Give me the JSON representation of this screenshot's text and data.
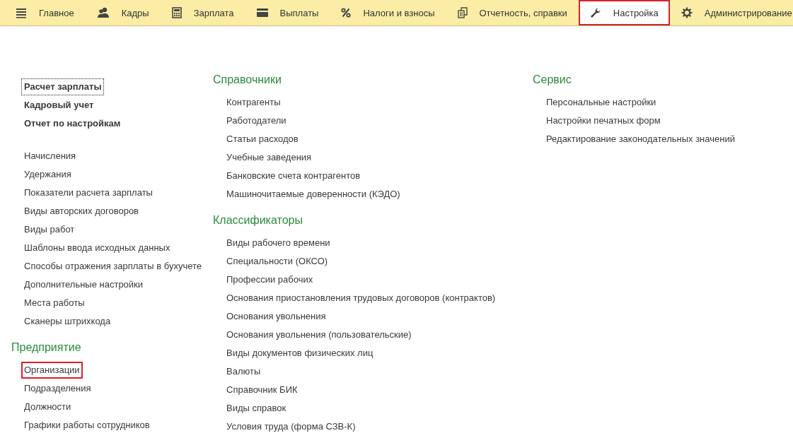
{
  "tabs": [
    {
      "label": "Главное",
      "selected": false,
      "highlighted": false
    },
    {
      "label": "Кадры",
      "selected": false,
      "highlighted": false
    },
    {
      "label": "Зарплата",
      "selected": false,
      "highlighted": false
    },
    {
      "label": "Выплаты",
      "selected": false,
      "highlighted": false
    },
    {
      "label": "Налоги и взносы",
      "selected": false,
      "highlighted": false
    },
    {
      "label": "Отчетность, справки",
      "selected": false,
      "highlighted": false
    },
    {
      "label": "Настройка",
      "selected": true,
      "highlighted": true
    },
    {
      "label": "Администрирование",
      "selected": false,
      "highlighted": false
    }
  ],
  "columns": [
    {
      "groups": [
        {
          "kind": "bold",
          "items": [
            {
              "label": "Расчет зарплаты",
              "focused": true,
              "highlighted": false
            },
            {
              "label": "Кадровый учет",
              "focused": false,
              "highlighted": false
            },
            {
              "label": "Отчет по настройкам",
              "focused": false,
              "highlighted": false
            }
          ]
        },
        {
          "kind": "plain",
          "items": [
            {
              "label": "Начисления",
              "focused": false,
              "highlighted": false
            },
            {
              "label": "Удержания",
              "focused": false,
              "highlighted": false
            },
            {
              "label": "Показатели расчета зарплаты",
              "focused": false,
              "highlighted": false
            },
            {
              "label": "Виды авторских договоров",
              "focused": false,
              "highlighted": false
            },
            {
              "label": "Виды работ",
              "focused": false,
              "highlighted": false
            },
            {
              "label": "Шаблоны ввода исходных данных",
              "focused": false,
              "highlighted": false
            },
            {
              "label": "Способы отражения зарплаты в бухучете",
              "focused": false,
              "highlighted": false
            },
            {
              "label": "Дополнительные настройки",
              "focused": false,
              "highlighted": false
            },
            {
              "label": "Места работы",
              "focused": false,
              "highlighted": false
            },
            {
              "label": "Сканеры штрихкода",
              "focused": false,
              "highlighted": false
            }
          ]
        },
        {
          "kind": "section",
          "title": "Предприятие",
          "items": [
            {
              "label": "Организации",
              "focused": false,
              "highlighted": true
            },
            {
              "label": "Подразделения",
              "focused": false,
              "highlighted": false
            },
            {
              "label": "Должности",
              "focused": false,
              "highlighted": false
            },
            {
              "label": "Графики работы сотрудников",
              "focused": false,
              "highlighted": false
            }
          ]
        }
      ]
    },
    {
      "groups": [
        {
          "kind": "section",
          "title": "Справочники",
          "items": [
            {
              "label": "Контрагенты",
              "focused": false,
              "highlighted": false
            },
            {
              "label": "Работодатели",
              "focused": false,
              "highlighted": false
            },
            {
              "label": "Статьи расходов",
              "focused": false,
              "highlighted": false
            },
            {
              "label": "Учебные заведения",
              "focused": false,
              "highlighted": false
            },
            {
              "label": "Банковские счета контрагентов",
              "focused": false,
              "highlighted": false
            },
            {
              "label": "Машиночитаемые доверенности (КЭДО)",
              "focused": false,
              "highlighted": false
            }
          ]
        },
        {
          "kind": "section",
          "title": "Классификаторы",
          "items": [
            {
              "label": "Виды рабочего времени",
              "focused": false,
              "highlighted": false
            },
            {
              "label": "Специальности (ОКСО)",
              "focused": false,
              "highlighted": false
            },
            {
              "label": "Профессии рабочих",
              "focused": false,
              "highlighted": false
            },
            {
              "label": "Основания приостановления трудовых договоров (контрактов)",
              "focused": false,
              "highlighted": false
            },
            {
              "label": "Основания увольнения",
              "focused": false,
              "highlighted": false
            },
            {
              "label": "Основания увольнения (пользовательские)",
              "focused": false,
              "highlighted": false
            },
            {
              "label": "Виды документов физических лиц",
              "focused": false,
              "highlighted": false
            },
            {
              "label": "Валюты",
              "focused": false,
              "highlighted": false
            },
            {
              "label": "Справочник БИК",
              "focused": false,
              "highlighted": false
            },
            {
              "label": "Виды справок",
              "focused": false,
              "highlighted": false
            },
            {
              "label": "Условия труда (форма СЗВ-К)",
              "focused": false,
              "highlighted": false
            }
          ]
        }
      ]
    },
    {
      "groups": [
        {
          "kind": "section",
          "title": "Сервис",
          "items": [
            {
              "label": "Персональные настройки",
              "focused": false,
              "highlighted": false
            },
            {
              "label": "Настройки печатных форм",
              "focused": false,
              "highlighted": false
            },
            {
              "label": "Редактирование законодательных значений",
              "focused": false,
              "highlighted": false
            }
          ]
        }
      ]
    }
  ]
}
